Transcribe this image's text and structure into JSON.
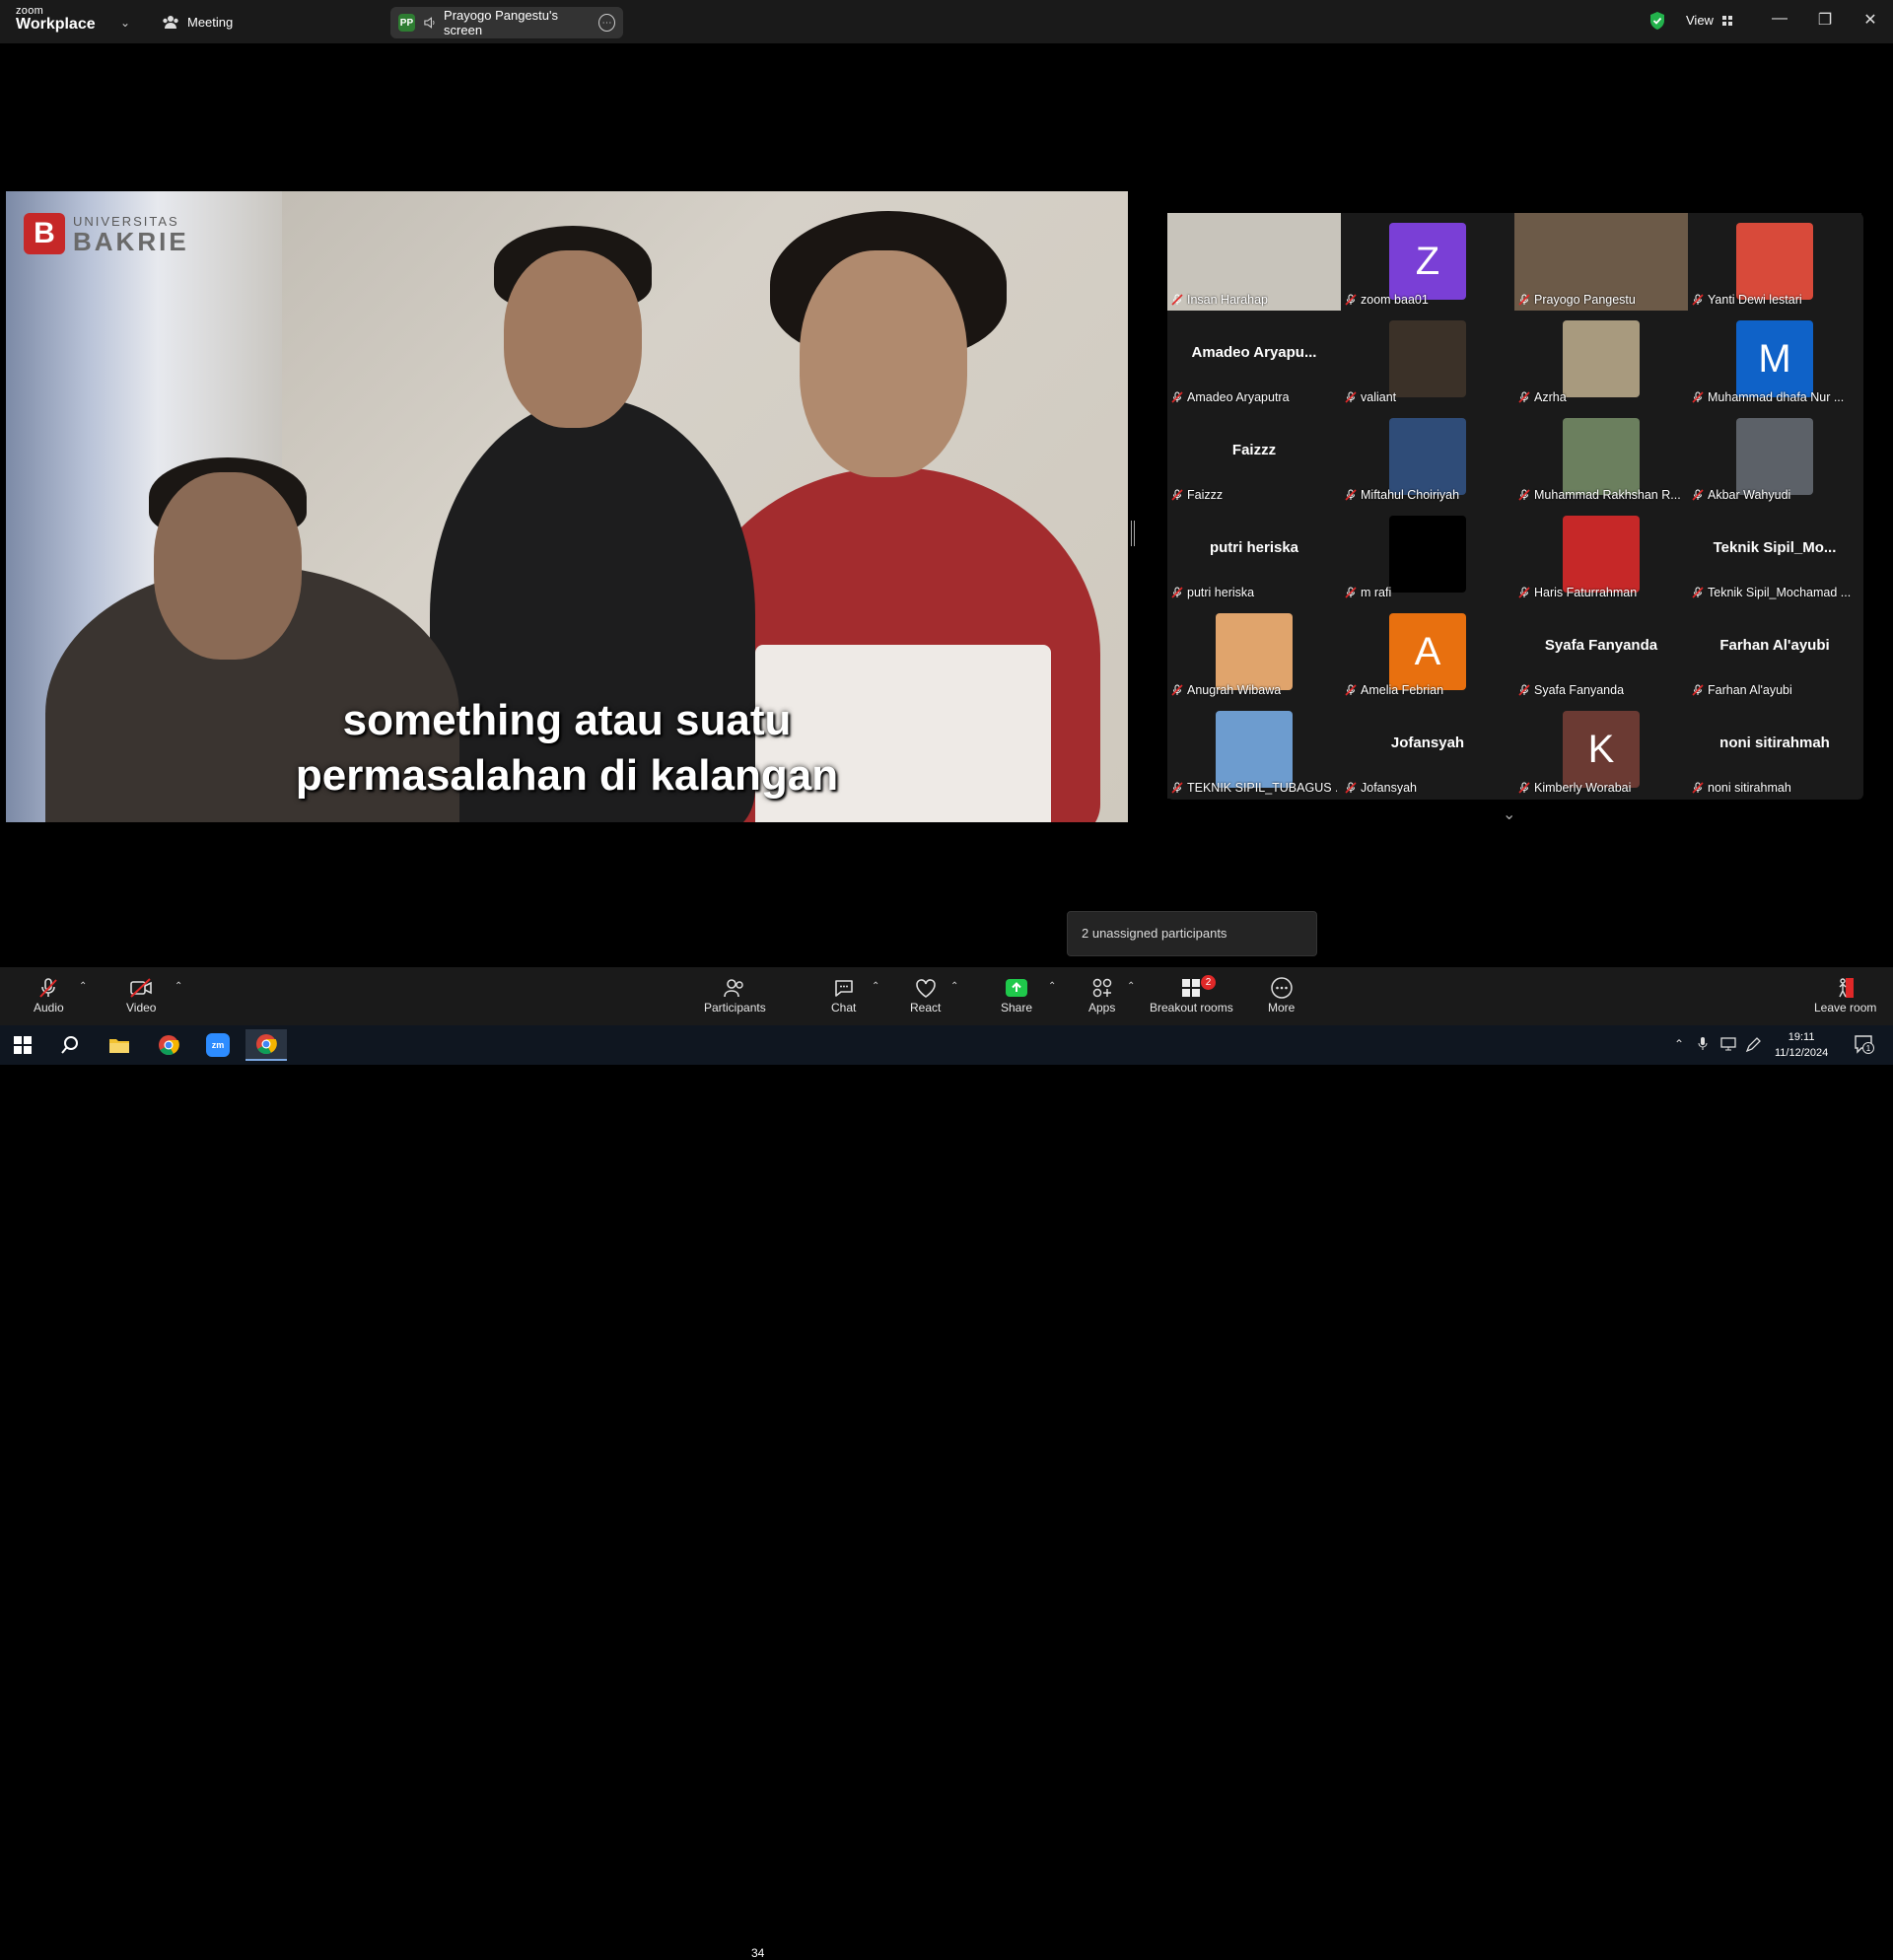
{
  "titlebar": {
    "logo_small": "zoom",
    "logo_big": "Workplace",
    "meeting_label": "Meeting",
    "share_initials": "PP",
    "share_label": "Prayogo Pangestu's screen",
    "view_label": "View"
  },
  "screen": {
    "logo_university": "UNIVERSITAS",
    "logo_name": "BAKRIE",
    "logo_mark": "B",
    "subtitle_line1": "something atau suatu",
    "subtitle_line2": "permasalahan di kalangan"
  },
  "gallery": {
    "tiles": [
      {
        "label": "Insan Harahap",
        "name": "",
        "type": "video",
        "color": "#c8c4bb",
        "active": true
      },
      {
        "label": "zoom baa01",
        "name": "",
        "type": "avatar",
        "letter": "Z",
        "color": "#7a3fd6"
      },
      {
        "label": "Prayogo Pangestu",
        "name": "",
        "type": "video",
        "color": "#6c5a48"
      },
      {
        "label": "Yanti Dewi lestari",
        "name": "",
        "type": "photo",
        "color": "#d84a3a"
      },
      {
        "label": "Amadeo Aryaputra",
        "name": "Amadeo Aryapu...",
        "type": "name"
      },
      {
        "label": "valiant",
        "name": "",
        "type": "photo",
        "color": "#3b3128"
      },
      {
        "label": "Azrha",
        "name": "",
        "type": "photo",
        "color": "#a89a7e"
      },
      {
        "label": "Muhammad dhafa Nur ...",
        "name": "",
        "type": "avatar",
        "letter": "M",
        "color": "#0f62c8"
      },
      {
        "label": "Faizzz",
        "name": "Faizzz",
        "type": "name"
      },
      {
        "label": "Miftahul Choiriyah",
        "name": "",
        "type": "photo",
        "color": "#2f4c78"
      },
      {
        "label": "Muhammad Rakhshan R...",
        "name": "",
        "type": "photo",
        "color": "#6b7f5e"
      },
      {
        "label": "Akbar Wahyudi",
        "name": "",
        "type": "photo",
        "color": "#5c6168"
      },
      {
        "label": "putri heriska",
        "name": "putri heriska",
        "type": "name"
      },
      {
        "label": "m rafi",
        "name": "",
        "type": "photo",
        "color": "#000000"
      },
      {
        "label": "Haris Faturrahman",
        "name": "",
        "type": "photo",
        "color": "#c62828"
      },
      {
        "label": "Teknik Sipil_Mochamad ...",
        "name": "Teknik  Sipil_Mo...",
        "type": "name"
      },
      {
        "label": "Anugrah Wibawa",
        "name": "",
        "type": "photo",
        "color": "#e0a46c"
      },
      {
        "label": "Amelia Febrian",
        "name": "",
        "type": "avatar",
        "letter": "A",
        "color": "#e8700f"
      },
      {
        "label": "Syafa Fanyanda",
        "name": "Syafa Fanyanda",
        "type": "name"
      },
      {
        "label": "Farhan Al'ayubi",
        "name": "Farhan Al'ayubi",
        "type": "name"
      },
      {
        "label": "TEKNIK SIPIL_TUBAGUS ...",
        "name": "",
        "type": "photo",
        "color": "#6d9ccf"
      },
      {
        "label": "Jofansyah",
        "name": "Jofansyah",
        "type": "name"
      },
      {
        "label": "Kimberly Worabai",
        "name": "",
        "type": "avatar",
        "letter": "K",
        "color": "#6b3a33"
      },
      {
        "label": "noni sitirahmah",
        "name": "noni sitirahmah",
        "type": "name"
      }
    ]
  },
  "tooltip": {
    "text": "2 unassigned participants"
  },
  "toolbar": {
    "audio": "Audio",
    "video": "Video",
    "participants": "Participants",
    "participants_count": "34",
    "chat": "Chat",
    "react": "React",
    "share": "Share",
    "apps": "Apps",
    "breakout": "Breakout rooms",
    "breakout_badge": "2",
    "more": "More",
    "leave": "Leave room"
  },
  "taskbar": {
    "time": "19:11",
    "date": "11/12/2024",
    "notification_count": "1"
  },
  "colors": {
    "accent_green": "#24c05a",
    "mute_red": "#e02828",
    "share_green": "#1fc94b"
  }
}
